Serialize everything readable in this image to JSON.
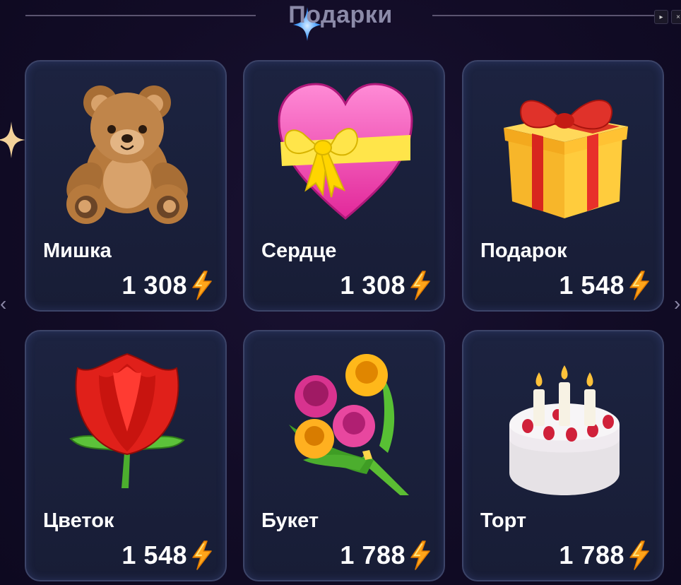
{
  "header": {
    "title": "Подарки"
  },
  "controls": {
    "play_icon": "play-icon",
    "close_icon": "close-icon",
    "play_label": "▸",
    "close_label": "×"
  },
  "nav": {
    "prev_label": "‹",
    "next_label": "›"
  },
  "colors": {
    "accent": "#ffb11a",
    "card_border": "#3c4468",
    "card_bg": "#1b2140"
  },
  "gifts": [
    {
      "name": "Мишка",
      "price": "1 308",
      "icon": "teddy-bear-icon"
    },
    {
      "name": "Сердце",
      "price": "1 308",
      "icon": "heart-with-ribbon-icon"
    },
    {
      "name": "Подарок",
      "price": "1 548",
      "icon": "wrapped-gift-icon"
    },
    {
      "name": "Цветок",
      "price": "1 548",
      "icon": "rose-icon"
    },
    {
      "name": "Букет",
      "price": "1 788",
      "icon": "bouquet-icon"
    },
    {
      "name": "Торт",
      "price": "1 788",
      "icon": "birthday-cake-icon"
    }
  ]
}
